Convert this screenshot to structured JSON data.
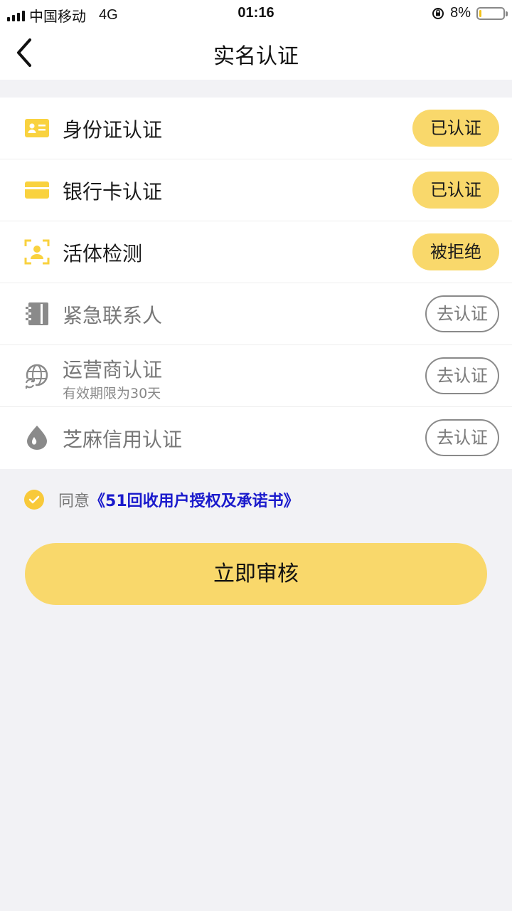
{
  "status_bar": {
    "carrier": "中国移动",
    "network": "4G",
    "time": "01:16",
    "battery_percent": "8%",
    "battery_level": 0.08
  },
  "header": {
    "title": "实名认证"
  },
  "items": [
    {
      "label": "身份证认证",
      "status": "已认证",
      "icon": "id-card-icon"
    },
    {
      "label": "银行卡认证",
      "status": "已认证",
      "icon": "bank-card-icon"
    },
    {
      "label": "活体检测",
      "status": "被拒绝",
      "icon": "face-scan-icon"
    },
    {
      "label": "紧急联系人",
      "status": "去认证",
      "icon": "contacts-book-icon"
    },
    {
      "label": "运营商认证",
      "sublabel": "有效期限为30天",
      "status": "去认证",
      "icon": "globe-refresh-icon"
    },
    {
      "label": "芝麻信用认证",
      "status": "去认证",
      "icon": "sesame-drop-icon"
    }
  ],
  "agreement": {
    "prefix": "同意",
    "link": "《51回收用户授权及承诺书》",
    "checked": true
  },
  "submit_label": "立即审核",
  "colors": {
    "accent_yellow": "#f9d86b",
    "link_blue": "#1a1acc",
    "background": "#f2f2f5"
  }
}
